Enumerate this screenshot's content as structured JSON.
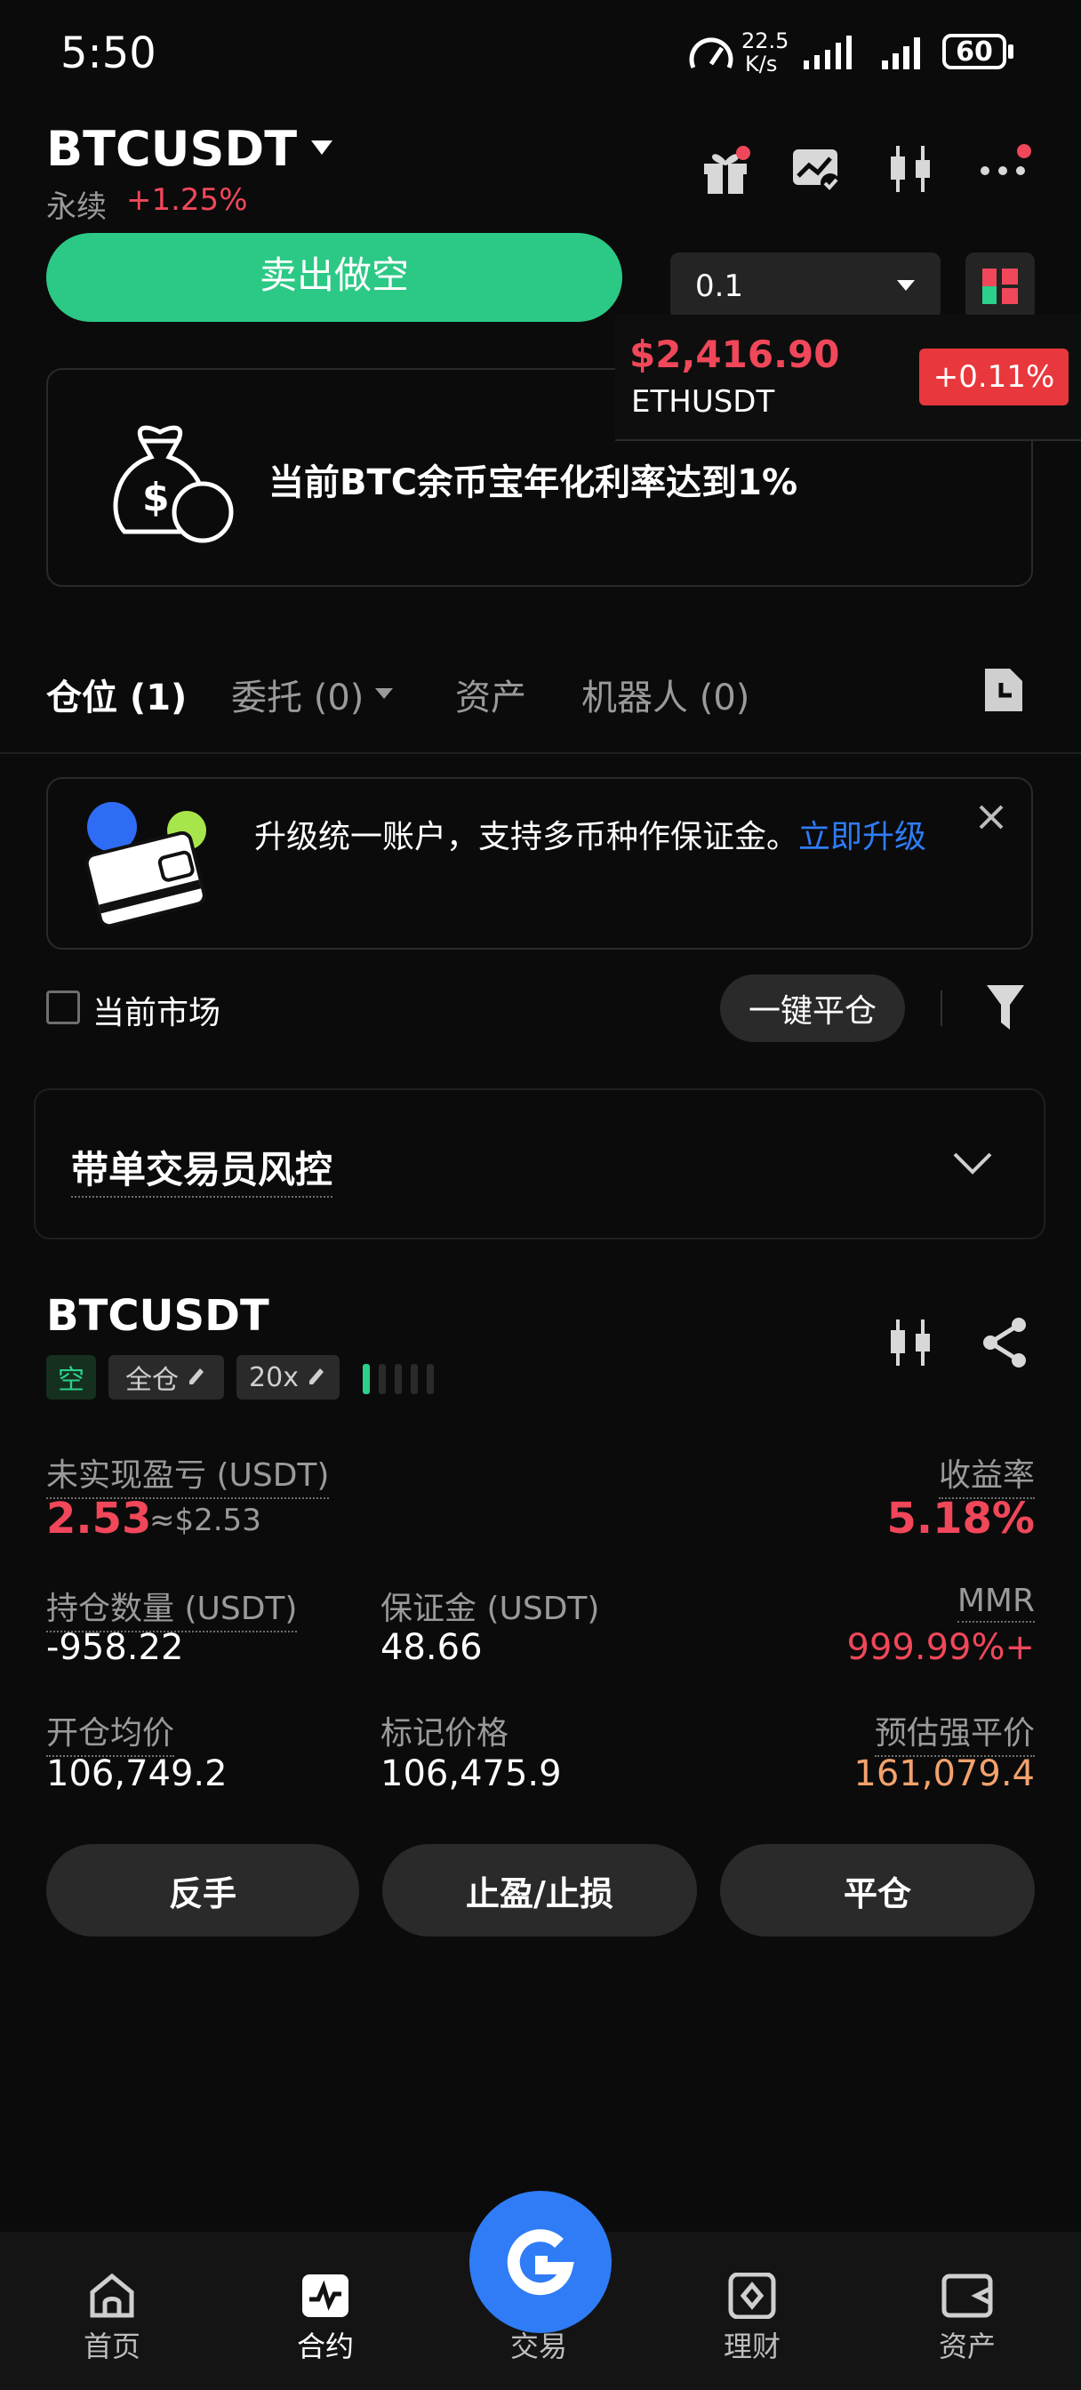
{
  "status_bar": {
    "time": "5:50",
    "net_speed_value": "22.5",
    "net_speed_unit": "K/s",
    "battery": "60"
  },
  "header": {
    "symbol": "BTCUSDT",
    "contract_type": "永续",
    "change": "+1.25%"
  },
  "order": {
    "sell_short_label": "卖出做空",
    "quantity": "0.1"
  },
  "ticker_popup": {
    "price": "$2,416.90",
    "symbol": "ETHUSDT",
    "change": "+0.11%"
  },
  "promo_banner": {
    "text": "当前BTC余币宝年化利率达到1%"
  },
  "tabs": [
    {
      "label": "仓位 (1)"
    },
    {
      "label": "委托 (0)"
    },
    {
      "label": "资产"
    },
    {
      "label": "机器人 (0)"
    }
  ],
  "upgrade_notice": {
    "text": "升级统一账户，支持多币种作保证金。",
    "link": "立即升级"
  },
  "filters": {
    "current_market_label": "当前市场",
    "close_all_label": "一键平仓"
  },
  "risk_control": {
    "title": "带单交易员风控"
  },
  "position": {
    "symbol": "BTCUSDT",
    "side_tag": "空",
    "margin_mode_tag": "全仓",
    "leverage_tag": "20x",
    "unrealized_pnl_label": "未实现盈亏 (USDT)",
    "unrealized_pnl": "2.53",
    "unrealized_pnl_usd": "≈$2.53",
    "roe_label": "收益率",
    "roe": "5.18%",
    "size_label": "持仓数量 (USDT)",
    "size": "-958.22",
    "margin_label": "保证金 (USDT)",
    "margin": "48.66",
    "mmr_label": "MMR",
    "mmr": "999.99%+",
    "entry_label": "开仓均价",
    "entry": "106,749.2",
    "mark_label": "标记价格",
    "mark": "106,475.9",
    "liq_label": "预估强平价",
    "liq": "161,079.4",
    "reverse_label": "反手",
    "tpsl_label": "止盈/止损",
    "close_label": "平仓"
  },
  "bottom_nav": [
    {
      "label": "首页",
      "icon": "home-icon"
    },
    {
      "label": "合约",
      "icon": "futures-icon"
    },
    {
      "label": "交易",
      "icon": "trade-logo-icon"
    },
    {
      "label": "理财",
      "icon": "earn-icon"
    },
    {
      "label": "资产",
      "icon": "wallet-icon"
    }
  ],
  "colors": {
    "background": "#0b0b0b",
    "green": "#2bd18a",
    "red": "#f0475a",
    "orange": "#f3a26d",
    "blue": "#2f7cf6"
  }
}
